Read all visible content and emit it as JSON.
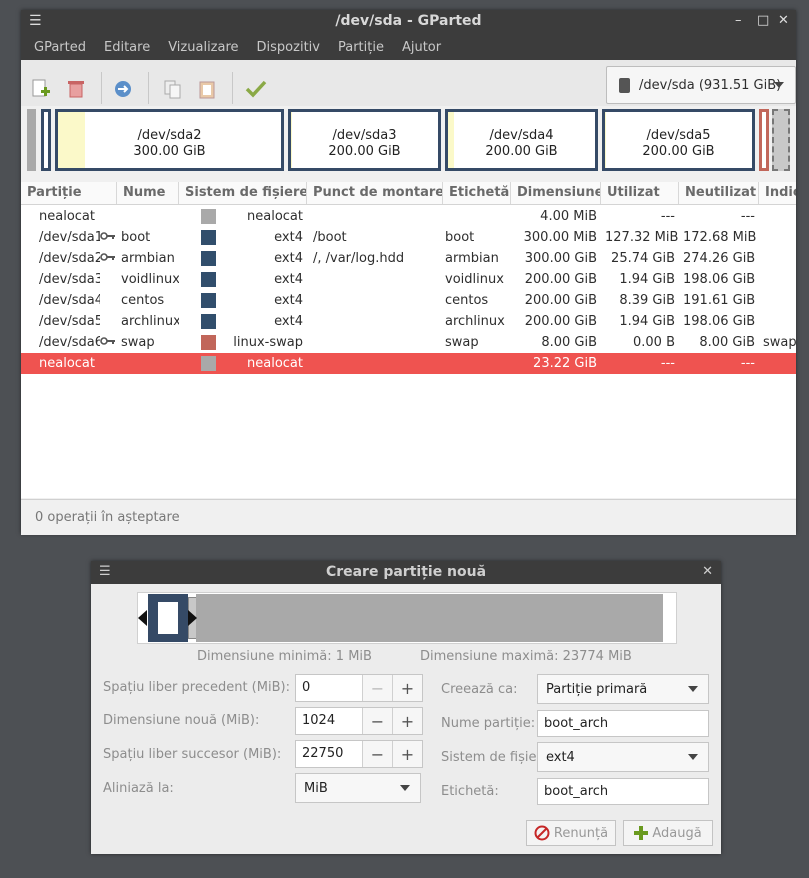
{
  "window": {
    "title": "/dev/sda - GParted"
  },
  "menu": [
    "GParted",
    "Editare",
    "Vizualizare",
    "Dispozitiv",
    "Partiție",
    "Ajutor"
  ],
  "toolbar": {
    "icons": [
      "new-icon",
      "delete-icon",
      "resize-move-icon",
      "copy-icon",
      "paste-icon",
      "apply-icon"
    ],
    "device_label": "/dev/sda (931.51 GiB)"
  },
  "diskmap": [
    {
      "name": "/dev/sda2",
      "size": "300.00 GiB",
      "used_fraction": 0.12
    },
    {
      "name": "/dev/sda3",
      "size": "200.00 GiB",
      "used_fraction": 0.01
    },
    {
      "name": "/dev/sda4",
      "size": "200.00 GiB",
      "used_fraction": 0.04
    },
    {
      "name": "/dev/sda5",
      "size": "200.00 GiB",
      "used_fraction": 0.01
    }
  ],
  "columns": [
    "Partiție",
    "Nume",
    "Sistem de fișiere",
    "Punct de montare",
    "Etichetă",
    "Dimensiune",
    "Utilizat",
    "Neutilizat",
    "Indic"
  ],
  "rows": [
    {
      "partition": "nealocat",
      "key": false,
      "name": "",
      "fs": "nealocat",
      "color": "#a9a9a9",
      "mount": "",
      "label": "",
      "size": "4.00 MiB",
      "used": "---",
      "unused": "---",
      "flags": ""
    },
    {
      "partition": "/dev/sda1",
      "key": true,
      "name": "boot",
      "fs": "ext4",
      "color": "#314e6c",
      "mount": "/boot",
      "label": "boot",
      "size": "300.00 MiB",
      "used": "127.32 MiB",
      "unused": "172.68 MiB",
      "flags": ""
    },
    {
      "partition": "/dev/sda2",
      "key": true,
      "name": "armbian",
      "fs": "ext4",
      "color": "#314e6c",
      "mount": "/, /var/log.hdd",
      "label": "armbian",
      "size": "300.00 GiB",
      "used": "25.74 GiB",
      "unused": "274.26 GiB",
      "flags": ""
    },
    {
      "partition": "/dev/sda3",
      "key": false,
      "name": "voidlinux",
      "fs": "ext4",
      "color": "#314e6c",
      "mount": "",
      "label": "voidlinux",
      "size": "200.00 GiB",
      "used": "1.94 GiB",
      "unused": "198.06 GiB",
      "flags": ""
    },
    {
      "partition": "/dev/sda4",
      "key": false,
      "name": "centos",
      "fs": "ext4",
      "color": "#314e6c",
      "mount": "",
      "label": "centos",
      "size": "200.00 GiB",
      "used": "8.39 GiB",
      "unused": "191.61 GiB",
      "flags": ""
    },
    {
      "partition": "/dev/sda5",
      "key": false,
      "name": "archlinux",
      "fs": "ext4",
      "color": "#314e6c",
      "mount": "",
      "label": "archlinux",
      "size": "200.00 GiB",
      "used": "1.94 GiB",
      "unused": "198.06 GiB",
      "flags": ""
    },
    {
      "partition": "/dev/sda6",
      "key": true,
      "name": "swap",
      "fs": "linux-swap",
      "color": "#c1665a",
      "mount": "",
      "label": "swap",
      "size": "8.00 GiB",
      "used": "0.00 B",
      "unused": "8.00 GiB",
      "flags": "swap"
    },
    {
      "partition": "nealocat",
      "key": false,
      "name": "",
      "fs": "nealocat",
      "color": "#a9a9a9",
      "mount": "",
      "label": "",
      "size": "23.22 GiB",
      "used": "---",
      "unused": "---",
      "flags": "",
      "selected": true
    }
  ],
  "status": "0 operații în așteptare",
  "dialog": {
    "title": "Creare partiție nouă",
    "min_size": "Dimensiune minimă: 1 MiB",
    "max_size": "Dimensiune maximă: 23774 MiB",
    "free_before_label": "Spațiu liber precedent (MiB):",
    "free_before": "0",
    "new_size_label": "Dimensiune nouă (MiB):",
    "new_size": "1024",
    "free_after_label": "Spațiu liber succesor (MiB):",
    "free_after": "22750",
    "align_label": "Aliniază la:",
    "align": "MiB",
    "create_as_label": "Creează ca:",
    "create_as": "Partiție primară",
    "part_name_label": "Nume partiție:",
    "part_name": "boot_arch",
    "fs_label": "Sistem de fișiere:",
    "fs": "ext4",
    "label_label": "Etichetă:",
    "label": "boot_arch",
    "cancel": "Renunță",
    "add": "Adaugă"
  }
}
